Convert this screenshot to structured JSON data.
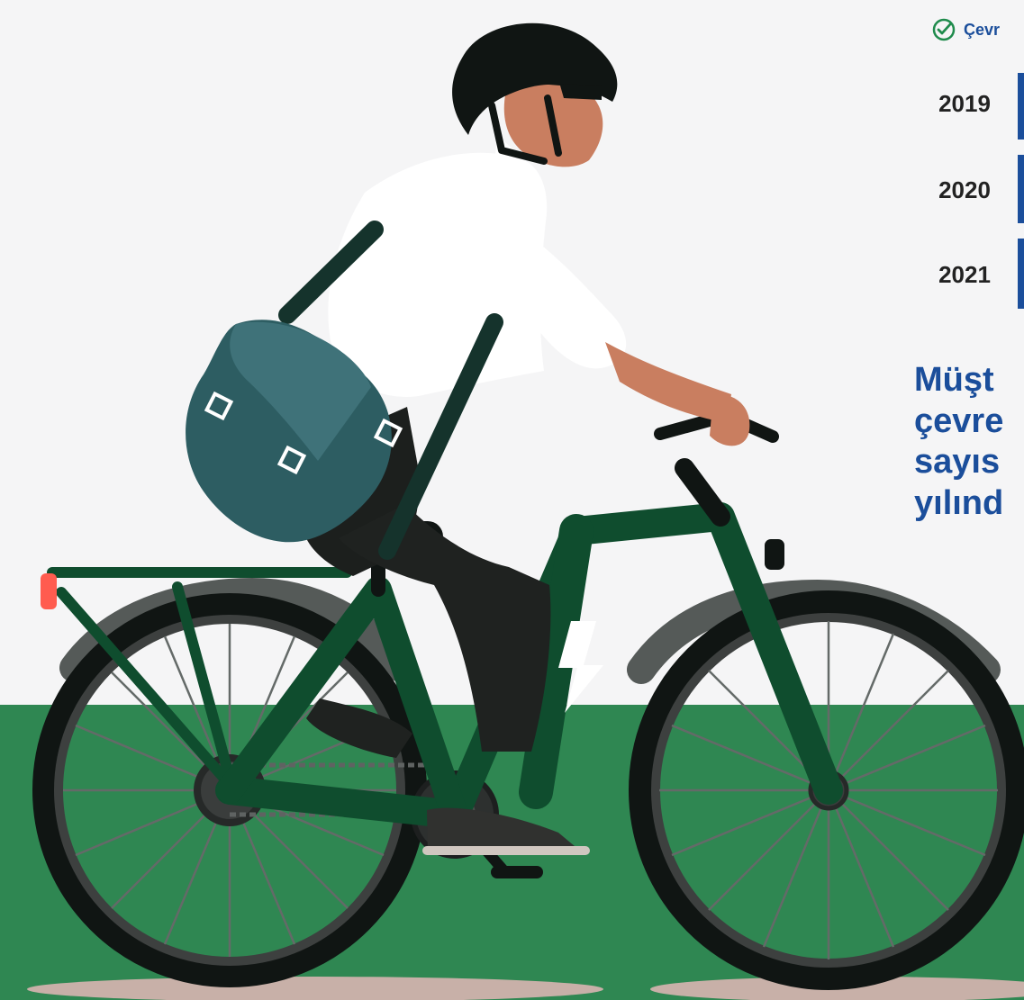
{
  "chart": {
    "label": "Çevr",
    "rows": [
      {
        "year": "2019"
      },
      {
        "year": "2020"
      },
      {
        "year": "2021"
      }
    ]
  },
  "headline_lines": [
    "Müşt",
    "çevre",
    "sayıs",
    "yılınd"
  ],
  "colors": {
    "ground": "#2f8752",
    "accent": "#1b4e9b",
    "bike_frame": "#0f4d2e",
    "background": "#f5f5f6"
  }
}
